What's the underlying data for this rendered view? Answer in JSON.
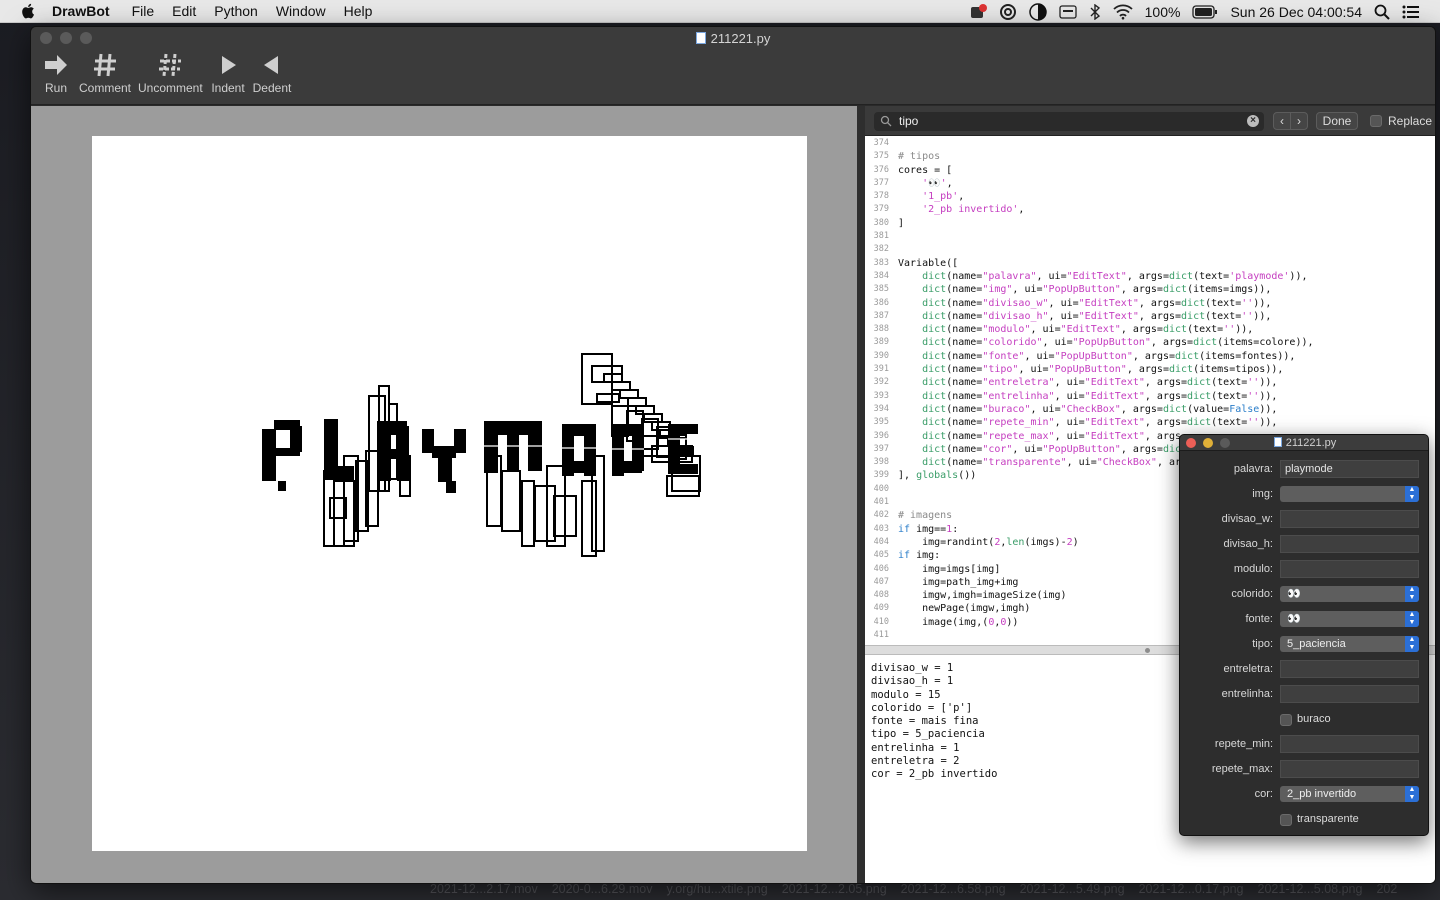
{
  "menubar": {
    "app_name": "DrawBot",
    "menus": [
      "File",
      "Edit",
      "Python",
      "Window",
      "Help"
    ],
    "battery": "100%",
    "clock": "Sun 26 Dec  04:00:54"
  },
  "window": {
    "title": "211221.py",
    "toolbar": {
      "run": "Run",
      "comment": "Comment",
      "uncomment": "Uncomment",
      "indent": "Indent",
      "dedent": "Dedent"
    }
  },
  "canvas": {
    "text": "PLAYMODE"
  },
  "findbar": {
    "query": "tipo",
    "done": "Done",
    "replace": "Replace"
  },
  "code_lines": [
    {
      "n": "374",
      "html": ""
    },
    {
      "n": "375",
      "html": "<span class='com'># tipos</span>"
    },
    {
      "n": "376",
      "html": "cores = ["
    },
    {
      "n": "377",
      "html": "    <span class='str'>'👀'</span>,"
    },
    {
      "n": "378",
      "html": "    <span class='str'>'1_pb'</span>,"
    },
    {
      "n": "379",
      "html": "    <span class='str'>'2_pb invertido'</span>,"
    },
    {
      "n": "380",
      "html": "]"
    },
    {
      "n": "381",
      "html": ""
    },
    {
      "n": "382",
      "html": ""
    },
    {
      "n": "383",
      "html": "Variable(["
    },
    {
      "n": "384",
      "html": "    <span class='fn'>dict</span>(name=<span class='str'>\"palavra\"</span>, ui=<span class='str'>\"EditText\"</span>, args=<span class='fn'>dict</span>(text=<span class='str'>'playmode'</span>)),"
    },
    {
      "n": "385",
      "html": "    <span class='fn'>dict</span>(name=<span class='str'>\"img\"</span>, ui=<span class='str'>\"PopUpButton\"</span>, args=<span class='fn'>dict</span>(items=imgs)),"
    },
    {
      "n": "386",
      "html": "    <span class='fn'>dict</span>(name=<span class='str'>\"divisao_w\"</span>, ui=<span class='str'>\"EditText\"</span>, args=<span class='fn'>dict</span>(text=<span class='str'>''</span>)),"
    },
    {
      "n": "387",
      "html": "    <span class='fn'>dict</span>(name=<span class='str'>\"divisao_h\"</span>, ui=<span class='str'>\"EditText\"</span>, args=<span class='fn'>dict</span>(text=<span class='str'>''</span>)),"
    },
    {
      "n": "388",
      "html": "    <span class='fn'>dict</span>(name=<span class='str'>\"modulo\"</span>, ui=<span class='str'>\"EditText\"</span>, args=<span class='fn'>dict</span>(text=<span class='str'>''</span>)),"
    },
    {
      "n": "389",
      "html": "    <span class='fn'>dict</span>(name=<span class='str'>\"colorido\"</span>, ui=<span class='str'>\"PopUpButton\"</span>, args=<span class='fn'>dict</span>(items=colore)),"
    },
    {
      "n": "390",
      "html": "    <span class='fn'>dict</span>(name=<span class='str'>\"fonte\"</span>, ui=<span class='str'>\"PopUpButton\"</span>, args=<span class='fn'>dict</span>(items=fontes)),"
    },
    {
      "n": "391",
      "html": "    <span class='fn'>dict</span>(name=<span class='str'>\"tipo\"</span>, ui=<span class='str'>\"PopUpButton\"</span>, args=<span class='fn'>dict</span>(items=tipos)),"
    },
    {
      "n": "392",
      "html": "    <span class='fn'>dict</span>(name=<span class='str'>\"entreletra\"</span>, ui=<span class='str'>\"EditText\"</span>, args=<span class='fn'>dict</span>(text=<span class='str'>''</span>)),"
    },
    {
      "n": "393",
      "html": "    <span class='fn'>dict</span>(name=<span class='str'>\"entrelinha\"</span>, ui=<span class='str'>\"EditText\"</span>, args=<span class='fn'>dict</span>(text=<span class='str'>''</span>)),"
    },
    {
      "n": "394",
      "html": "    <span class='fn'>dict</span>(name=<span class='str'>\"buraco\"</span>, ui=<span class='str'>\"CheckBox\"</span>, args=<span class='fn'>dict</span>(value=<span class='kw'>False</span>)),"
    },
    {
      "n": "395",
      "html": "    <span class='fn'>dict</span>(name=<span class='str'>\"repete_min\"</span>, ui=<span class='str'>\"EditText\"</span>, args=<span class='fn'>dict</span>(text=<span class='str'>''</span>)),"
    },
    {
      "n": "396",
      "html": "    <span class='fn'>dict</span>(name=<span class='str'>\"repete_max\"</span>, ui=<span class='str'>\"EditText\"</span>, args"
    },
    {
      "n": "397",
      "html": "    <span class='fn'>dict</span>(name=<span class='str'>\"cor\"</span>, ui=<span class='str'>\"PopUpButton\"</span>, args=<span class='fn'>dic</span>"
    },
    {
      "n": "398",
      "html": "    <span class='fn'>dict</span>(name=<span class='str'>\"transparente\"</span>, ui=<span class='str'>\"CheckBox\"</span>, ar"
    },
    {
      "n": "399",
      "html": "], <span class='fn'>globals</span>())"
    },
    {
      "n": "400",
      "html": ""
    },
    {
      "n": "401",
      "html": ""
    },
    {
      "n": "402",
      "html": "<span class='com'># imagens</span>"
    },
    {
      "n": "403",
      "html": "<span class='kw'>if</span> img==<span class='num'>1</span>:"
    },
    {
      "n": "404",
      "html": "    img=randint(<span class='num'>2</span>,<span class='fn'>len</span>(imgs)-<span class='num'>2</span>)"
    },
    {
      "n": "405",
      "html": "<span class='kw'>if</span> img:"
    },
    {
      "n": "406",
      "html": "    img=imgs[img]"
    },
    {
      "n": "407",
      "html": "    img=path_img+img"
    },
    {
      "n": "408",
      "html": "    imgw,imgh=imageSize(img)"
    },
    {
      "n": "409",
      "html": "    newPage(imgw,imgh)"
    },
    {
      "n": "410",
      "html": "    image(img,(<span class='num'>0</span>,<span class='num'>0</span>))"
    },
    {
      "n": "411",
      "html": ""
    }
  ],
  "output_lines": [
    "divisao_w = 1",
    "divisao_h = 1",
    "modulo = 15",
    "colorido = ['p']",
    "fonte = mais fina",
    "tipo = 5_paciencia",
    "entrelinha = 1",
    "entreletra = 2",
    "cor = 2_pb invertido"
  ],
  "variables_panel": {
    "title": "211221.py",
    "rows": [
      {
        "label": "palavra:",
        "kind": "text",
        "value": "playmode"
      },
      {
        "label": "img:",
        "kind": "popup",
        "value": ""
      },
      {
        "label": "divisao_w:",
        "kind": "text",
        "value": ""
      },
      {
        "label": "divisao_h:",
        "kind": "text",
        "value": ""
      },
      {
        "label": "modulo:",
        "kind": "text",
        "value": ""
      },
      {
        "label": "colorido:",
        "kind": "popup",
        "value": "👀"
      },
      {
        "label": "fonte:",
        "kind": "popup",
        "value": "👀"
      },
      {
        "label": "tipo:",
        "kind": "popup",
        "value": "5_paciencia"
      },
      {
        "label": "entreletra:",
        "kind": "text",
        "value": ""
      },
      {
        "label": "entrelinha:",
        "kind": "text",
        "value": ""
      },
      {
        "label": "",
        "kind": "check",
        "value": "buraco"
      },
      {
        "label": "repete_min:",
        "kind": "text",
        "value": ""
      },
      {
        "label": "repete_max:",
        "kind": "text",
        "value": ""
      },
      {
        "label": "cor:",
        "kind": "popup",
        "value": "2_pb invertido"
      },
      {
        "label": "",
        "kind": "check",
        "value": "transparente"
      }
    ]
  },
  "dock_files": [
    "2021-12...2.17.mov",
    "2020-0...6.29.mov",
    "y.org/hu...xtile.png",
    "2021-12...2.05.png",
    "2021-12...6.58.png",
    "2021-12...5.49.png",
    "2021-12...0.17.png",
    "2021-12...5.08.png",
    "202"
  ],
  "colors": {
    "accent": "#2b6fd6",
    "string": "#c53ec0",
    "keyword": "#2a7dc9",
    "builtin": "#3a9d68"
  }
}
